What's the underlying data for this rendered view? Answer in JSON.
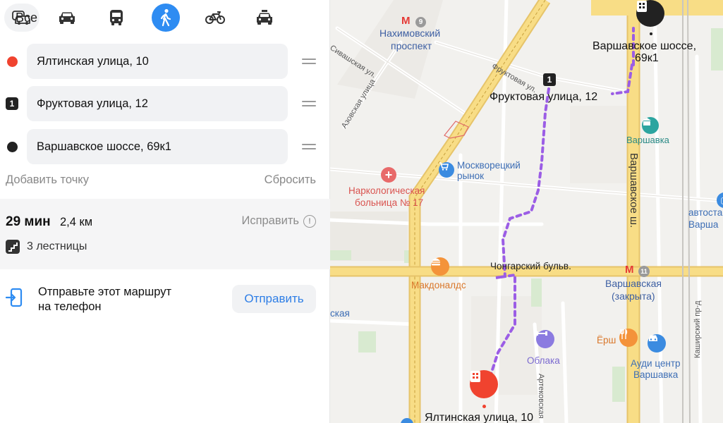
{
  "modes": {
    "all_label": "Все",
    "items": [
      "car-icon",
      "bus-icon",
      "pedestrian-icon",
      "bicycle-icon",
      "taxi-icon"
    ],
    "active": "pedestrian-icon"
  },
  "waypoints": [
    {
      "marker": "red-dot",
      "value": "Ялтинская улица, 10"
    },
    {
      "marker": "1",
      "value": "Фруктовая улица, 12"
    },
    {
      "marker": "black-dot",
      "value": "Варшавское шоссе, 69к1"
    }
  ],
  "actions": {
    "add_point": "Добавить точку",
    "reset": "Сбросить"
  },
  "route": {
    "time": "29 мин",
    "distance": "2,4 км",
    "fix_label": "Исправить",
    "stairs": "3 лестницы"
  },
  "send": {
    "text_line1": "Отправьте этот маршрут",
    "text_line2": "на телефон",
    "button": "Отправить"
  },
  "map": {
    "labels": {
      "metro_nakhim_1": "Нахимовский",
      "metro_nakhim_2": "проспект",
      "metro_nakhim_line": "9",
      "sivash": "Сивашская ул.",
      "azov": "Азовская улица",
      "fruktovaya_street": "Фруктовая ул.",
      "waypoint_1_marker": "1",
      "waypoint_1_label": "Фруктовая улица, 12",
      "dest_1": "Варшавское шоссе,",
      "dest_2": "69к1",
      "varshavka_station": "Варшавка",
      "varsh_shosse_vertical": "Варшавское ш.",
      "market_1": "Москворецкий",
      "market_2": "рынок",
      "hospital_1": "Наркологическая",
      "hospital_2": "больница № 17",
      "mcd": "Макдоналдс",
      "chongar": "Чонгарский бульв.",
      "metro_varsh_1": "Варшавская",
      "metro_varsh_2": "(закрыта)",
      "metro_varsh_line": "11",
      "oblaka": "Облака",
      "ersh": "Ёрш",
      "audi_1": "Ауди центр",
      "audi_2": "Варшавка",
      "artekov": "Артековская",
      "kashir": "Каширский пр-д",
      "avtosta_1": "автоста",
      "avtosta_2": "Варша",
      "cut_left": "ская",
      "origin_label": "Ялтинская улица, 10"
    },
    "colors": {
      "route": "#9b5de5",
      "metro": "#e53935",
      "orange_poi": "#f4933a",
      "blue_poi": "#3b8be0",
      "violet_poi": "#8b7be0",
      "hospital": "#e86a6a",
      "origin_pin": "#f0432f"
    }
  }
}
